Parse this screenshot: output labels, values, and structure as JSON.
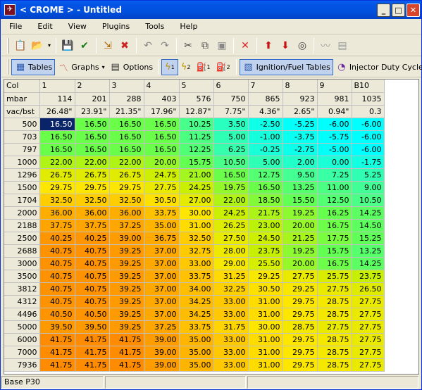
{
  "window": {
    "title": "< CROME > - Untitled",
    "icon_name": "crome-app-icon",
    "minimize_glyph": "_",
    "maximize_glyph": "□",
    "close_glyph": "✕"
  },
  "menu": [
    "File",
    "Edit",
    "View",
    "Plugins",
    "Tools",
    "Help"
  ],
  "toolbar1": [
    {
      "name": "clipboard-icon",
      "glyph": "📋",
      "color": "#555555"
    },
    {
      "name": "open-folder-icon",
      "glyph": "📂",
      "color": "#c89000"
    },
    {
      "name": "open-dropdown-icon",
      "glyph": "▾",
      "color": "#000000",
      "drop": true
    },
    {
      "sep": true
    },
    {
      "name": "save-icon",
      "glyph": "💾",
      "color": "#1a3a9a"
    },
    {
      "name": "save-check-icon",
      "glyph": "✔",
      "color": "#1a7a1a"
    },
    {
      "sep": true
    },
    {
      "name": "import-icon",
      "glyph": "⇲",
      "color": "#aa6600"
    },
    {
      "name": "close-doc-icon",
      "glyph": "✖",
      "color": "#cc2222"
    },
    {
      "sep": true
    },
    {
      "name": "undo-icon",
      "glyph": "↶",
      "color": "#888888"
    },
    {
      "name": "redo-icon",
      "glyph": "↷",
      "color": "#888888"
    },
    {
      "sep": true
    },
    {
      "name": "cut-icon",
      "glyph": "✂",
      "color": "#444444"
    },
    {
      "name": "copy-icon",
      "glyph": "⧉",
      "color": "#444444"
    },
    {
      "name": "paste-icon",
      "glyph": "▣",
      "color": "#888888"
    },
    {
      "sep": true
    },
    {
      "name": "delete-icon",
      "glyph": "✕",
      "color": "#dd2222"
    },
    {
      "sep": true
    },
    {
      "name": "arrow-up-icon",
      "glyph": "⬆",
      "color": "#cc1111"
    },
    {
      "name": "arrow-down-icon",
      "glyph": "⬇",
      "color": "#cc1111"
    },
    {
      "name": "target-icon",
      "glyph": "◎",
      "color": "#444444"
    },
    {
      "sep": true
    },
    {
      "name": "graph-line-icon",
      "glyph": "〰",
      "color": "#999999"
    },
    {
      "name": "spreadsheet-icon",
      "glyph": "▤",
      "color": "#999999"
    }
  ],
  "toolbar2": {
    "tables_label": "Tables",
    "graphs_label": "Graphs",
    "options_label": "Options",
    "ignition_label": "Ignition/Fuel Tables",
    "injector_label": "Injector Duty Cycle",
    "tables_icon": "table-icon",
    "graphs_icon": "graph-icon",
    "options_icon": "options-icon",
    "ign1_icon": "ignition-1-icon",
    "ign2_icon": "ignition-2-icon",
    "fuel1_icon": "fuel-1-icon",
    "fuel2_icon": "fuel-2-icon",
    "ignfuel_icon": "ignition-fuel-icon",
    "injector_icon": "injector-duty-icon",
    "sub_1": "1",
    "sub_2": "2"
  },
  "table": {
    "col_header_label": "Col",
    "columns": [
      "1",
      "2",
      "3",
      "4",
      "5",
      "6",
      "7",
      "8",
      "9",
      "B10"
    ],
    "mbar_label": "mbar",
    "mbar": [
      "114",
      "201",
      "288",
      "403",
      "576",
      "750",
      "865",
      "923",
      "981",
      "1035"
    ],
    "vac_label": "vac/bst",
    "vac": [
      "26.48\"",
      "23.91\"",
      "21.35\"",
      "17.96\"",
      "12.87\"",
      "7.75\"",
      "4.36\"",
      "2.65\"",
      "0.94\"",
      "0.3"
    ],
    "rows": [
      {
        "rpm": "500",
        "values": [
          "16.50",
          "16.50",
          "16.50",
          "16.50",
          "10.25",
          "3.50",
          "-2.50",
          "-5.25",
          "-6.00",
          "-6.00"
        ]
      },
      {
        "rpm": "703",
        "values": [
          "16.50",
          "16.50",
          "16.50",
          "16.50",
          "11.25",
          "5.00",
          "-1.00",
          "-3.75",
          "-5.75",
          "-6.00"
        ]
      },
      {
        "rpm": "797",
        "values": [
          "16.50",
          "16.50",
          "16.50",
          "16.50",
          "12.25",
          "6.25",
          "-0.25",
          "-2.75",
          "-5.00",
          "-6.00"
        ]
      },
      {
        "rpm": "1000",
        "values": [
          "22.00",
          "22.00",
          "22.00",
          "20.00",
          "15.75",
          "10.50",
          "5.00",
          "2.00",
          "0.00",
          "-1.75"
        ]
      },
      {
        "rpm": "1296",
        "values": [
          "26.75",
          "26.75",
          "26.75",
          "24.75",
          "21.00",
          "16.50",
          "12.75",
          "9.50",
          "7.25",
          "5.25"
        ]
      },
      {
        "rpm": "1500",
        "values": [
          "29.75",
          "29.75",
          "29.75",
          "27.75",
          "24.25",
          "19.75",
          "16.50",
          "13.25",
          "11.00",
          "9.00"
        ]
      },
      {
        "rpm": "1704",
        "values": [
          "32.50",
          "32.50",
          "32.50",
          "30.50",
          "27.00",
          "22.00",
          "18.50",
          "15.50",
          "12.50",
          "10.50"
        ]
      },
      {
        "rpm": "2000",
        "values": [
          "36.00",
          "36.00",
          "36.00",
          "33.75",
          "30.00",
          "24.25",
          "21.75",
          "19.25",
          "16.25",
          "14.25"
        ]
      },
      {
        "rpm": "2188",
        "values": [
          "37.75",
          "37.75",
          "37.25",
          "35.00",
          "31.00",
          "26.25",
          "23.00",
          "20.00",
          "16.75",
          "14.50"
        ]
      },
      {
        "rpm": "2500",
        "values": [
          "40.25",
          "40.25",
          "39.00",
          "36.75",
          "32.50",
          "27.50",
          "24.50",
          "21.25",
          "17.75",
          "15.25"
        ]
      },
      {
        "rpm": "2688",
        "values": [
          "40.75",
          "40.75",
          "39.25",
          "37.00",
          "32.75",
          "28.00",
          "23.75",
          "19.25",
          "15.75",
          "13.25"
        ]
      },
      {
        "rpm": "3000",
        "values": [
          "40.75",
          "40.75",
          "39.25",
          "37.00",
          "33.00",
          "29.00",
          "25.50",
          "20.00",
          "16.75",
          "14.25"
        ]
      },
      {
        "rpm": "3500",
        "values": [
          "40.75",
          "40.75",
          "39.25",
          "37.00",
          "33.75",
          "31.25",
          "29.25",
          "27.75",
          "25.75",
          "23.75"
        ]
      },
      {
        "rpm": "3812",
        "values": [
          "40.75",
          "40.75",
          "39.25",
          "37.00",
          "34.00",
          "32.25",
          "30.50",
          "29.25",
          "27.75",
          "26.50"
        ]
      },
      {
        "rpm": "4312",
        "values": [
          "40.75",
          "40.75",
          "39.25",
          "37.00",
          "34.25",
          "33.00",
          "31.00",
          "29.75",
          "28.75",
          "27.75"
        ]
      },
      {
        "rpm": "4496",
        "values": [
          "40.50",
          "40.50",
          "39.25",
          "37.00",
          "34.25",
          "33.00",
          "31.00",
          "29.75",
          "28.75",
          "27.75"
        ]
      },
      {
        "rpm": "5000",
        "values": [
          "39.50",
          "39.50",
          "39.25",
          "37.25",
          "33.75",
          "31.75",
          "30.00",
          "28.75",
          "27.75",
          "27.75"
        ]
      },
      {
        "rpm": "6000",
        "values": [
          "41.75",
          "41.75",
          "41.75",
          "39.00",
          "35.00",
          "33.00",
          "31.00",
          "29.75",
          "28.75",
          "27.75"
        ]
      },
      {
        "rpm": "7000",
        "values": [
          "41.75",
          "41.75",
          "41.75",
          "39.00",
          "35.00",
          "33.00",
          "31.00",
          "29.75",
          "28.75",
          "27.75"
        ]
      },
      {
        "rpm": "7936",
        "values": [
          "41.75",
          "41.75",
          "41.75",
          "39.00",
          "35.00",
          "33.00",
          "31.00",
          "29.75",
          "28.75",
          "27.75"
        ]
      }
    ],
    "selected_cell_value": "16.50",
    "color_scale": {
      "cyan": "#00ffff",
      "green": "#55ff55",
      "yellow": "#ffff00",
      "orange": "#ff8c00",
      "header": "#ece9d8",
      "selection": "#0a246a"
    }
  },
  "status": {
    "left": "Base P30",
    "mid": "",
    "right": ""
  }
}
